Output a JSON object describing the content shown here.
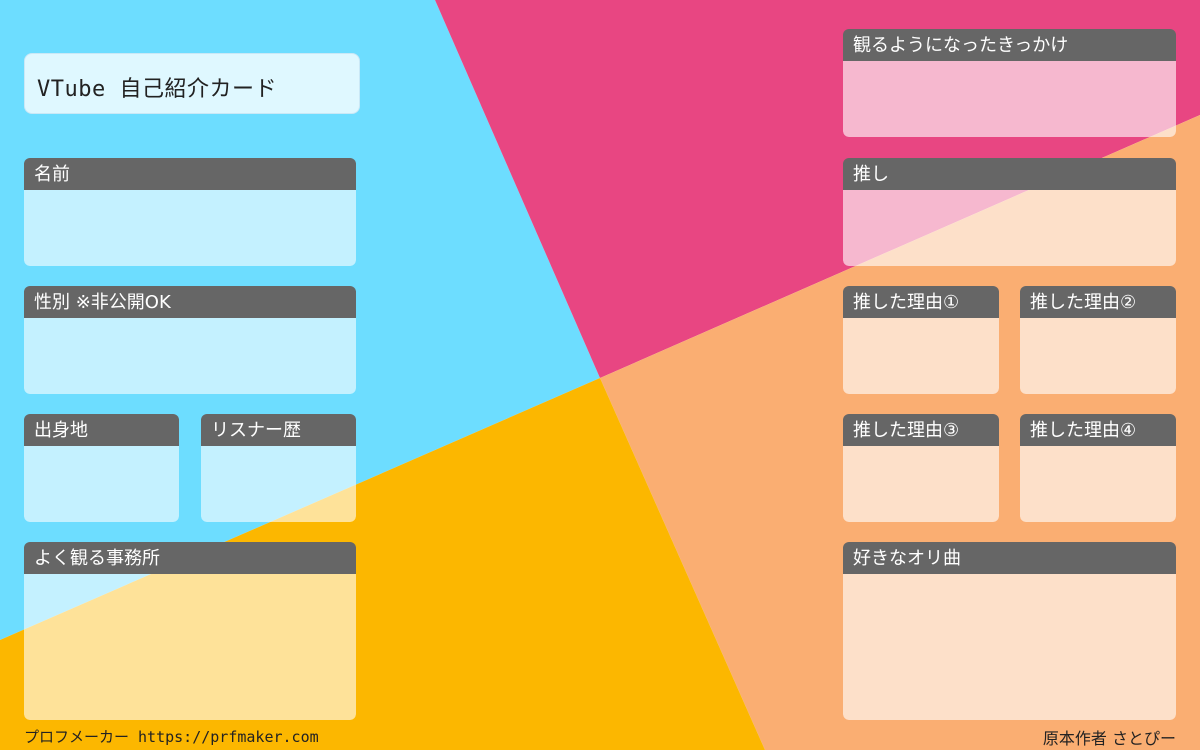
{
  "title": "VTube 自己紹介カード",
  "colors": {
    "cyan": "#6DDDFF",
    "pink": "#E84682",
    "orange": "#FAAE72",
    "yellow": "#FCB700",
    "header": "#666666"
  },
  "fields": {
    "name": "名前",
    "gender": "性別 ※非公開OK",
    "hometown": "出身地",
    "listener_history": "リスナー歴",
    "agency": "よく観る事務所",
    "trigger": "観るようになったきっかけ",
    "oshi": "推し",
    "reason1": "推した理由①",
    "reason2": "推した理由②",
    "reason3": "推した理由③",
    "reason4": "推した理由④",
    "favorite_song": "好きなオリ曲"
  },
  "footer": {
    "left": "プロフメーカー https://prfmaker.com",
    "right": "原本作者 さとぴー"
  }
}
